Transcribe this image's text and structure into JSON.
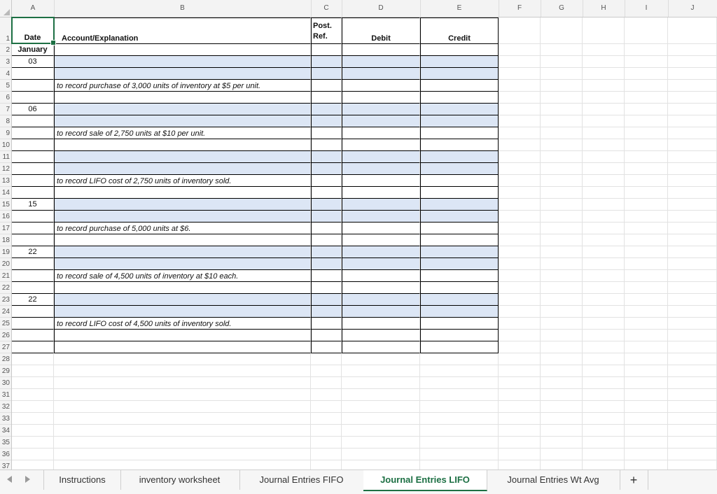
{
  "columns": [
    "A",
    "B",
    "C",
    "D",
    "E",
    "F",
    "G",
    "H",
    "I",
    "J"
  ],
  "rows": [
    "1",
    "2",
    "3",
    "4",
    "5",
    "6",
    "7",
    "8",
    "9",
    "10",
    "11",
    "12",
    "13",
    "14",
    "15",
    "16",
    "17",
    "18",
    "19",
    "20",
    "21",
    "22",
    "23",
    "24",
    "25",
    "26",
    "27",
    "28",
    "29",
    "30",
    "31",
    "32",
    "33",
    "34",
    "35",
    "36",
    "37"
  ],
  "headers": {
    "date": "Date",
    "account": "Account/Explanation",
    "post_line1": "Post.",
    "post_line2": "Ref.",
    "debit": "Debit",
    "credit": "Credit"
  },
  "entries": {
    "month": "January",
    "d1": "03",
    "d2": "06",
    "d3": "15",
    "d4": "22",
    "d5": "22",
    "e1": "to record purchase of 3,000 units of inventory at $5 per unit.",
    "e2": "to record sale of  2,750 units at $10 per unit.",
    "e3": "to record LIFO cost of  2,750 units of inventory sold.",
    "e4": "to record purchase of 5,000 units at $6.",
    "e5": "to record sale of 4,500 units of inventory at $10 each.",
    "e6": "to record LIFO cost of 4,500 units of inventory sold."
  },
  "tabs": [
    "Instructions",
    "inventory worksheet",
    "Journal Entries FIFO",
    "Journal Entries LIFO",
    "Journal Entries Wt Avg"
  ],
  "active_tab": "Journal Entries LIFO",
  "add_sheet": "+",
  "colors": {
    "accent": "#1d7044",
    "shade": "#dce6f5"
  }
}
